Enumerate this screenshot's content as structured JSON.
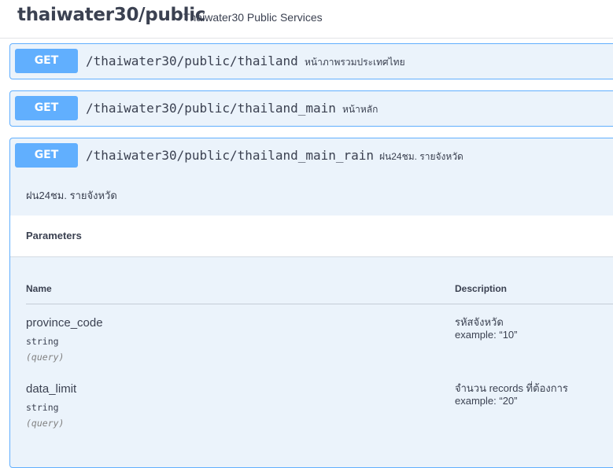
{
  "tag": {
    "name": "thaiwater30/public",
    "description": "Thaiwater30 Public Services"
  },
  "operations": [
    {
      "method": "GET",
      "path": "/thaiwater30/public/thailand",
      "summary": "หน้าภาพรวมประเทศไทย"
    },
    {
      "method": "GET",
      "path": "/thaiwater30/public/thailand_main",
      "summary": "หน้าหลัก"
    },
    {
      "method": "GET",
      "path": "/thaiwater30/public/thailand_main_rain",
      "summary": "ฝน24ชม. รายจังหวัด",
      "description": "ฝน24ชม. รายจังหวัด",
      "parameters_title": "Parameters",
      "columns": {
        "name": "Name",
        "description": "Description"
      },
      "parameters": [
        {
          "name": "province_code",
          "type": "string",
          "in": "(query)",
          "description": "รหัสจังหวัด",
          "example": "example: “10”"
        },
        {
          "name": "data_limit",
          "type": "string",
          "in": "(query)",
          "description": "จำนวน records ที่ต้องการ",
          "example": "example: “20”"
        }
      ]
    }
  ],
  "colors": {
    "get_accent": "#61affe",
    "get_background": "#ebf3fb",
    "text": "#3b4151"
  }
}
